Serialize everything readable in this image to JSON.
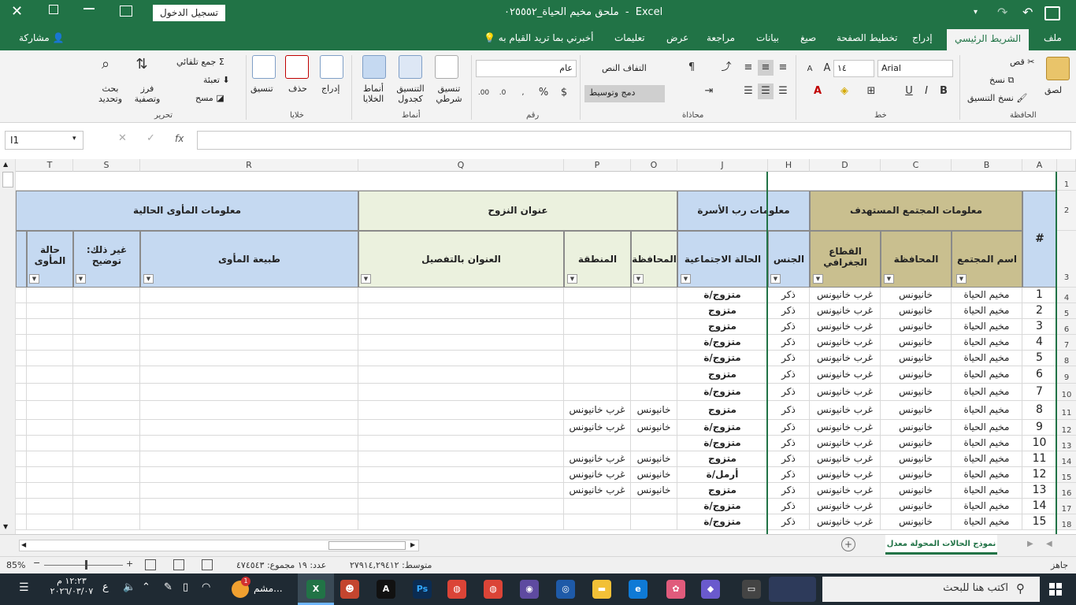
{
  "window": {
    "title": "ملحق مخيم الحياة_٠٢٥٥٥٢",
    "app": "Excel",
    "separator": "-",
    "signin_label": "تسجيل الدخول"
  },
  "tabs": [
    "ملف",
    "الشريط الرئيسي",
    "إدراج",
    "تخطيط الصفحة",
    "صيغ",
    "بيانات",
    "مراجعة",
    "عرض",
    "تعليمات"
  ],
  "tell_me": "أخبرني بما تريد القيام به",
  "share": "مشاركة",
  "ribbon": {
    "clipboard": {
      "paste": "لصق",
      "cut": "قص",
      "copy": "نسخ",
      "format_painter": "نسخ التنسيق",
      "group": "الحافظة"
    },
    "font": {
      "name": "Arial",
      "size": "١٤",
      "bold": "B",
      "italic": "I",
      "underline": "U",
      "group": "خط"
    },
    "alignment": {
      "wrap": "التفاف النص",
      "merge": "دمج وتوسيط",
      "group": "محاذاة"
    },
    "number": {
      "format": "عام",
      "group": "رقم"
    },
    "styles": {
      "conditional": "تنسيق شرطي",
      "as_table": "التنسيق كجدول",
      "cell_styles": "أنماط الخلايا",
      "group": "أنماط"
    },
    "cells": {
      "insert": "إدراج",
      "delete": "حذف",
      "format": "تنسيق",
      "group": "خلايا"
    },
    "editing": {
      "autosum": "جمع تلقائي",
      "fill": "تعبئة",
      "clear": "مسح",
      "sort": "فرز وتصفية",
      "find": "بحث وتحديد",
      "group": "تحرير"
    }
  },
  "formula_bar": {
    "name_box": "I1",
    "fx": "fx",
    "value": ""
  },
  "columns": [
    "A",
    "B",
    "C",
    "D",
    "H",
    "J",
    "O",
    "P",
    "Q",
    "R",
    "S",
    "T"
  ],
  "headers": {
    "group_community": "معلومات المجتمع المستهدف",
    "group_head": "معلومات رب الأسرة",
    "group_address": "عنوان النزوح",
    "group_shelter": "معلومات المأوى الحالية",
    "hash": "#",
    "community_name": "اسم المجتمع",
    "governorate": "المحافظة",
    "sector": "القطاع الجغرافي",
    "gender": "الجنس",
    "social_status": "الحالة الاجتماعية",
    "addr_governorate": "المحافظة",
    "region": "المنطقة",
    "detailed_address": "العنوان بالتفصيل",
    "shelter_type": "طبيعة المأوى",
    "other": "غير ذلك: توضيح",
    "shelter_status": "حالة المأوى"
  },
  "row_numbers": [
    "1",
    "2",
    "3",
    "4",
    "5",
    "6",
    "7",
    "8",
    "9",
    "10",
    "11",
    "12",
    "13",
    "14",
    "15",
    "16",
    "17",
    "18"
  ],
  "rows": [
    {
      "n": "1",
      "community": "مخيم الحياة",
      "gov": "خانيونس",
      "sector": "غرب خانيونس",
      "gender": "ذكر",
      "status": "متزوج/ة",
      "agov": "",
      "region": "",
      "address": ""
    },
    {
      "n": "2",
      "community": "مخيم الحياة",
      "gov": "خانيونس",
      "sector": "غرب خانيونس",
      "gender": "ذكر",
      "status": "متزوج",
      "agov": "",
      "region": "",
      "address": ""
    },
    {
      "n": "3",
      "community": "مخيم الحياة",
      "gov": "خانيونس",
      "sector": "غرب خانيونس",
      "gender": "ذكر",
      "status": "متزوج",
      "agov": "",
      "region": "",
      "address": ""
    },
    {
      "n": "4",
      "community": "مخيم الحياة",
      "gov": "خانيونس",
      "sector": "غرب خانيونس",
      "gender": "ذكر",
      "status": "متزوج/ة",
      "agov": "",
      "region": "",
      "address": ""
    },
    {
      "n": "5",
      "community": "مخيم الحياة",
      "gov": "خانيونس",
      "sector": "غرب خانيونس",
      "gender": "ذكر",
      "status": "متزوج/ة",
      "agov": "",
      "region": "",
      "address": ""
    },
    {
      "n": "6",
      "community": "مخيم الحياة",
      "gov": "خانيونس",
      "sector": "غرب خانيونس",
      "gender": "ذكر",
      "status": "متزوج",
      "agov": "",
      "region": "",
      "address": ""
    },
    {
      "n": "7",
      "community": "مخيم الحياة",
      "gov": "خانيونس",
      "sector": "غرب خانيونس",
      "gender": "ذكر",
      "status": "متزوج/ة",
      "agov": "",
      "region": "",
      "address": ""
    },
    {
      "n": "8",
      "community": "مخيم الحياة",
      "gov": "خانيونس",
      "sector": "غرب خانيونس",
      "gender": "ذكر",
      "status": "متزوج",
      "agov": "خانيونس",
      "region": "غرب خانيونس",
      "address": ""
    },
    {
      "n": "9",
      "community": "مخيم الحياة",
      "gov": "خانيونس",
      "sector": "غرب خانيونس",
      "gender": "ذكر",
      "status": "متزوج/ة",
      "agov": "خانيونس",
      "region": "غرب خانيونس",
      "address": ""
    },
    {
      "n": "10",
      "community": "مخيم الحياة",
      "gov": "خانيونس",
      "sector": "غرب خانيونس",
      "gender": "ذكر",
      "status": "متزوج/ة",
      "agov": "",
      "region": "",
      "address": ""
    },
    {
      "n": "11",
      "community": "مخيم الحياة",
      "gov": "خانيونس",
      "sector": "غرب خانيونس",
      "gender": "ذكر",
      "status": "متزوج",
      "agov": "خانيونس",
      "region": "غرب خانيونس",
      "address": ""
    },
    {
      "n": "12",
      "community": "مخيم الحياة",
      "gov": "خانيونس",
      "sector": "غرب خانيونس",
      "gender": "ذكر",
      "status": "أرمل/ة",
      "agov": "خانيونس",
      "region": "غرب خانيونس",
      "address": ""
    },
    {
      "n": "13",
      "community": "مخيم الحياة",
      "gov": "خانيونس",
      "sector": "غرب خانيونس",
      "gender": "ذكر",
      "status": "متزوج",
      "agov": "خانيونس",
      "region": "غرب خانيونس",
      "address": ""
    },
    {
      "n": "14",
      "community": "مخيم الحياة",
      "gov": "خانيونس",
      "sector": "غرب خانيونس",
      "gender": "ذكر",
      "status": "متزوج/ة",
      "agov": "",
      "region": "",
      "address": ""
    },
    {
      "n": "15",
      "community": "مخيم الحياة",
      "gov": "خانيونس",
      "sector": "غرب خانيونس",
      "gender": "ذكر",
      "status": "متزوج/ة",
      "agov": "",
      "region": "",
      "address": ""
    }
  ],
  "sheet_tab": "نموذج الحالات المحولة معدل",
  "status": {
    "ready": "جاهز",
    "average": "متوسط: ٢٧٩١٤,٢٩٤١٢",
    "count": "عدد: ١٩",
    "sum": "مجموع: ٤٧٤٥٤٣",
    "zoom": "85%"
  },
  "taskbar": {
    "search": "اكتب هنا للبحث",
    "time": "١٢:٢٣ م",
    "date": "٢٠٢٦/٠٣/٠٧",
    "lang": "ع",
    "share_app": "مشم...",
    "badge": "1"
  },
  "colors": {
    "excel_green": "#217346",
    "tan": "#c9bf8f",
    "blue": "#c5d9f1",
    "green_light": "#ebf1de"
  }
}
